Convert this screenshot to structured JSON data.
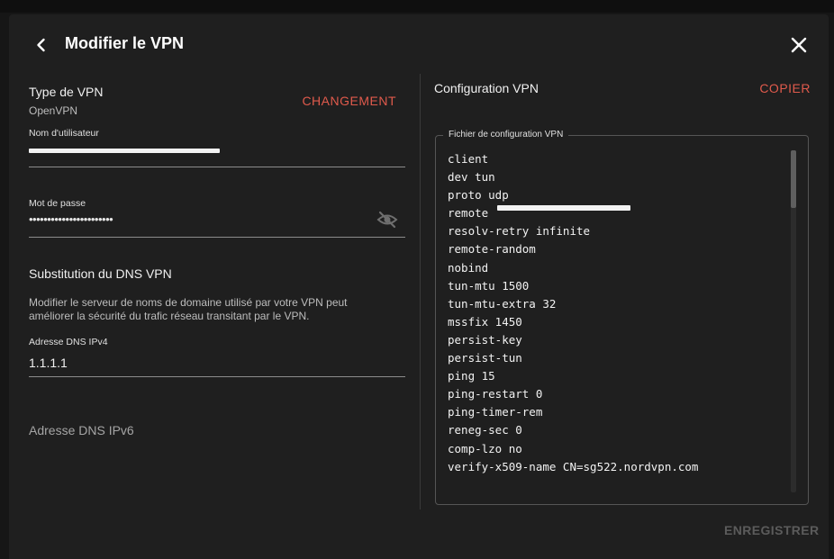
{
  "header": {
    "title": "Modifier le VPN",
    "back_icon": "chevron-left-icon",
    "close_icon": "close-icon"
  },
  "vpn_type": {
    "label": "Type de VPN",
    "value": "OpenVPN",
    "change_label": "CHANGEMENT"
  },
  "username": {
    "label": "Nom d'utilisateur",
    "value": ""
  },
  "password": {
    "label": "Mot de passe",
    "value": "•••••••••••••••••••••••",
    "toggle_icon": "eye-off-icon"
  },
  "dns": {
    "heading": "Substitution du DNS VPN",
    "description_line1": "Modifier le serveur de noms de domaine utilisé par votre VPN peut",
    "description_line2": "améliorer la sécurité du trafic réseau transitant par le VPN.",
    "ipv4_label": "Adresse DNS IPv4",
    "ipv4_value": "1.1.1.1",
    "ipv6_placeholder": "Adresse DNS IPv6"
  },
  "config": {
    "heading": "Configuration VPN",
    "copy_label": "COPIER",
    "file_label": "Fichier de configuration VPN",
    "lines": [
      "client",
      "dev tun",
      "proto udp",
      "remote",
      "resolv-retry infinite",
      "remote-random",
      "nobind",
      "tun-mtu 1500",
      "tun-mtu-extra 32",
      "mssfix 1450",
      "persist-key",
      "persist-tun",
      "ping 15",
      "ping-restart 0",
      "ping-timer-rem",
      "reneg-sec 0",
      "comp-lzo no",
      "verify-x509-name CN=sg522.nordvpn.com"
    ]
  },
  "footer": {
    "save_label": "ENREGISTRER"
  },
  "colors": {
    "accent": "#e05a4c",
    "dialog_bg": "#1f1f1f",
    "disabled": "#5b5b5b"
  }
}
